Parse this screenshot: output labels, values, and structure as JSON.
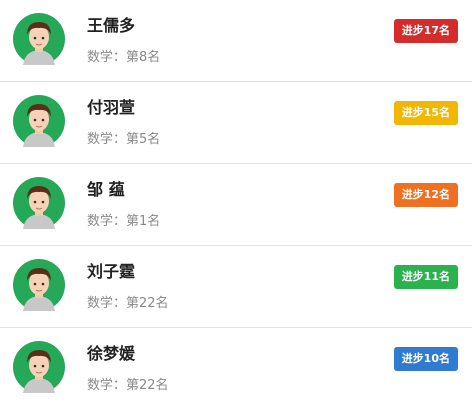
{
  "list": {
    "items": [
      {
        "name": "王儒多",
        "subject": "数学：第8名",
        "badge": "进步17名",
        "badge_color": "#d62b2b"
      },
      {
        "name": "付羽萱",
        "subject": "数学：第5名",
        "badge": "进步15名",
        "badge_color": "#f2b705"
      },
      {
        "name": "邹 蕴",
        "subject": "数学：第1名",
        "badge": "进步12名",
        "badge_color": "#ee7020"
      },
      {
        "name": "刘子霆",
        "subject": "数学：第22名",
        "badge": "进步11名",
        "badge_color": "#2bb24c"
      },
      {
        "name": "徐梦媛",
        "subject": "数学：第22名",
        "badge": "进步10名",
        "badge_color": "#2e7bd1"
      }
    ]
  },
  "icons": {
    "avatar": "user-avatar-icon"
  }
}
